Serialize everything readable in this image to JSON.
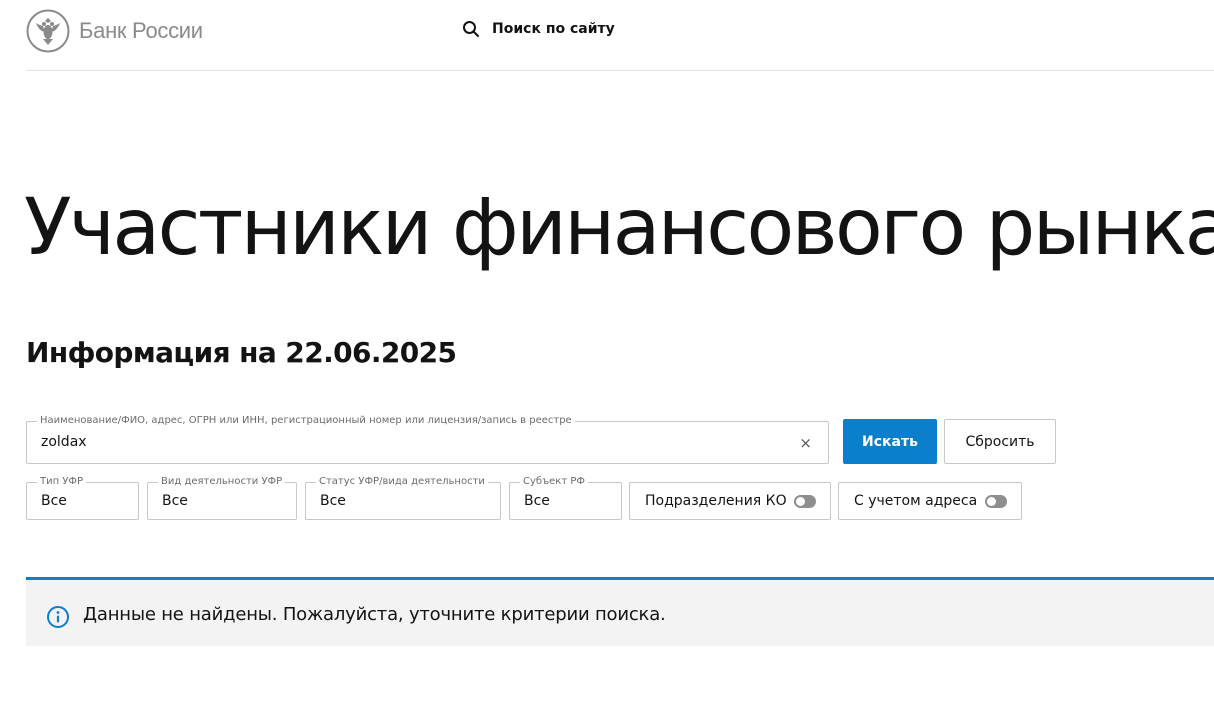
{
  "header": {
    "logo_text": "Банк России",
    "site_search_label": "Поиск по сайту"
  },
  "page": {
    "title": "Участники финансового рынка",
    "info_date": "Информация на 22.06.2025"
  },
  "search": {
    "legend": "Наименование/ФИО, адрес, ОГРН или ИНН, регистрационный номер или лицензия/запись в реестре",
    "value": "zoldax",
    "clear_symbol": "×",
    "search_button": "Искать",
    "reset_button": "Сбросить"
  },
  "filters": {
    "type": {
      "legend": "Тип УФР",
      "value": "Все"
    },
    "activity": {
      "legend": "Вид деятельности УФР",
      "value": "Все"
    },
    "status": {
      "legend": "Статус УФР/вида деятельности",
      "value": "Все"
    },
    "region": {
      "legend": "Субъект РФ",
      "value": "Все"
    },
    "toggle_ko": {
      "label": "Подразделения КО",
      "on": false
    },
    "toggle_address": {
      "label": "С учетом адреса",
      "on": false
    }
  },
  "notice": {
    "text": "Данные не найдены. Пожалуйста, уточните критерии поиска."
  },
  "colors": {
    "accent": "#0b7fcb",
    "text": "#131313",
    "notice_bg": "#f3f3f3"
  },
  "icons": {
    "logo": "double-headed-eagle-emblem",
    "search": "search-icon",
    "clear": "close-icon",
    "notice": "info-icon"
  }
}
